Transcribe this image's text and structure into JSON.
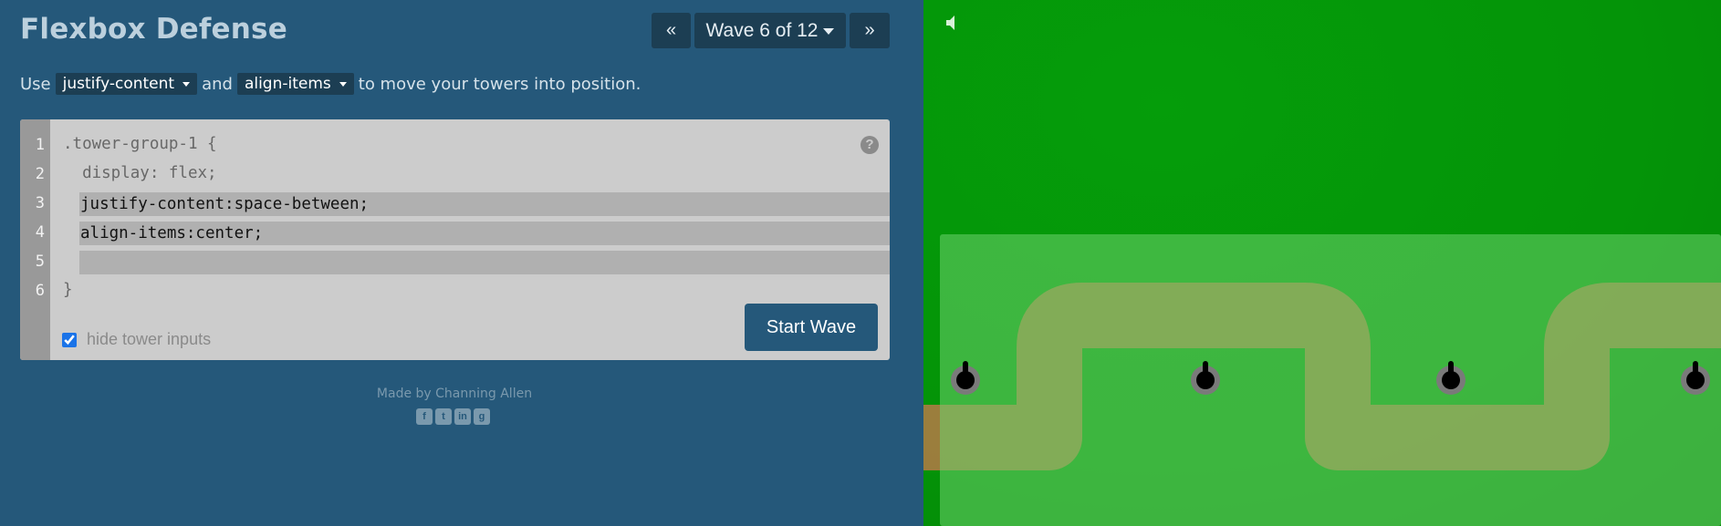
{
  "header": {
    "title": "Flexbox Defense",
    "prev_label": "«",
    "wave_label": "Wave 6 of 12",
    "next_label": "»"
  },
  "instructions": {
    "prefix": "Use",
    "prop1": "justify-content",
    "conjunction": "and",
    "prop2": "align-items",
    "suffix": "to move your towers into position."
  },
  "editor": {
    "line_numbers": [
      "1",
      "2",
      "3",
      "4",
      "5",
      "6"
    ],
    "line1": ".tower-group-1 {",
    "line2": "  display: flex;",
    "input1": "justify-content:space-between;",
    "input2": "align-items:center;",
    "input3": "",
    "line6": "}",
    "help_label": "?",
    "hide_label": "hide tower inputs",
    "hide_checked": true,
    "start_label": "Start Wave"
  },
  "footer": {
    "credit": "Made by Channing Allen",
    "social": [
      {
        "icon": "facebook-icon",
        "glyph": "f"
      },
      {
        "icon": "twitter-icon",
        "glyph": "t"
      },
      {
        "icon": "linkedin-icon",
        "glyph": "in"
      },
      {
        "icon": "github-icon",
        "glyph": "g"
      }
    ]
  },
  "board": {
    "grass_color": "#049408",
    "zone_color": "#42b84a",
    "path_color": "#a87c42",
    "tower_count": 4
  }
}
